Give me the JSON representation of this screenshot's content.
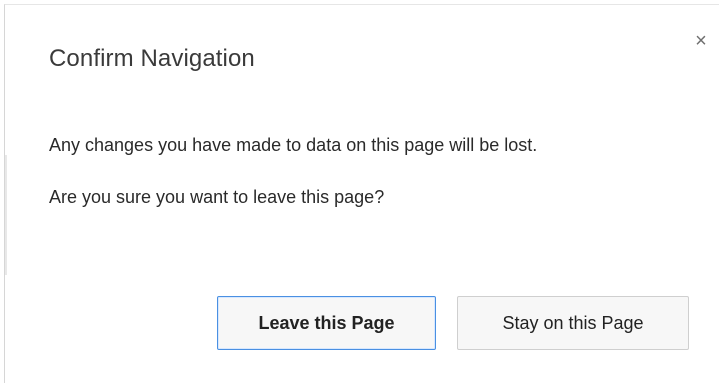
{
  "dialog": {
    "title": "Confirm Navigation",
    "close_glyph": "×",
    "message_line1": "Any changes you have made to data on this page will be lost.",
    "message_line2": "Are you sure you want to leave this page?",
    "buttons": {
      "leave_label": "Leave this Page",
      "stay_label": "Stay on this Page"
    },
    "colors": {
      "background": "#ffffff",
      "accent_focus": "#4a90e2",
      "button_bg": "#f7f7f7"
    }
  }
}
